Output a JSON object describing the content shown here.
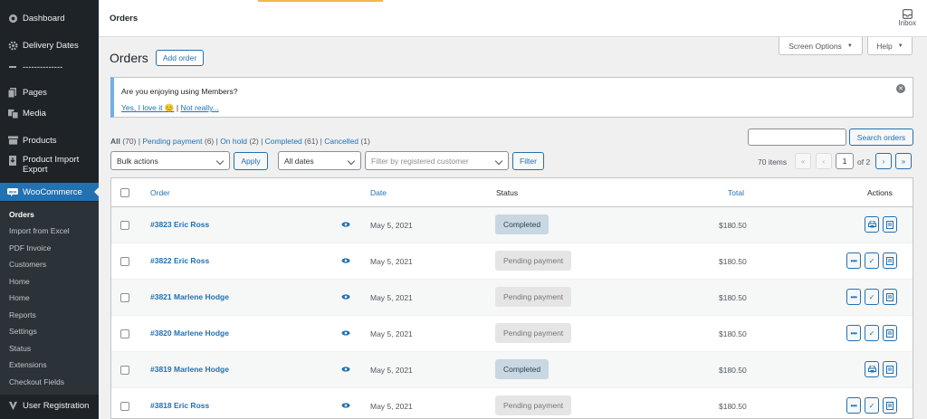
{
  "sidebar": {
    "items": [
      {
        "icon": "dashboard-icon",
        "label": "Dashboard"
      },
      {
        "icon": "gear-icon",
        "label": "Delivery Dates"
      },
      {
        "icon": "separator-icon",
        "label": "--------------"
      },
      {
        "icon": "pages-icon",
        "label": "Pages"
      },
      {
        "icon": "media-icon",
        "label": "Media"
      },
      {
        "icon": "products-icon",
        "label": "Products"
      },
      {
        "icon": "import-icon",
        "label": "Product Import Export"
      },
      {
        "icon": "woocommerce-icon",
        "label": "WooCommerce"
      }
    ],
    "submenu": [
      "Orders",
      "Import from Excel",
      "PDF Invoice",
      "Customers",
      "Home",
      "Home",
      "Reports",
      "Settings",
      "Status",
      "Extensions",
      "Checkout Fields"
    ],
    "bottom_item": {
      "icon": "user-registration-icon",
      "label": "User Registration"
    }
  },
  "topbar": {
    "title": "Orders",
    "inbox_label": "Inbox"
  },
  "screen_options_label": "Screen Options",
  "help_label": "Help",
  "page": {
    "title": "Orders",
    "add_order_label": "Add order"
  },
  "notice": {
    "text": "Are you enjoying using Members?",
    "yes_link": "Yes, I love it",
    "emoji": "😊",
    "separator": " | ",
    "no_link": "Not really..."
  },
  "filters": {
    "all": {
      "label": "All",
      "count": "(70)"
    },
    "pending": {
      "label": "Pending payment",
      "count": "(6)"
    },
    "on_hold": {
      "label": "On hold",
      "count": "(2)"
    },
    "completed": {
      "label": "Completed",
      "count": "(61)"
    },
    "cancelled": {
      "label": "Cancelled",
      "count": "(1)"
    },
    "sep": " | "
  },
  "toolbar": {
    "bulk_actions": "Bulk actions",
    "apply_label": "Apply",
    "all_dates": "All dates",
    "customer_placeholder": "Filter by registered customer",
    "filter_label": "Filter",
    "search_button": "Search orders",
    "items_count": "70 items",
    "current_page": "1",
    "of_pages": "of 2",
    "first": "«",
    "prev": "‹",
    "next": "›",
    "last": "»"
  },
  "table": {
    "columns": {
      "order": "Order",
      "date": "Date",
      "status": "Status",
      "total": "Total",
      "actions": "Actions"
    },
    "rows": [
      {
        "order": "#3823 Eric Ross",
        "date": "May 5, 2021",
        "status": "Completed",
        "status_type": "completed",
        "total": "$180.50"
      },
      {
        "order": "#3822 Eric Ross",
        "date": "May 5, 2021",
        "status": "Pending payment",
        "status_type": "pending",
        "total": "$180.50"
      },
      {
        "order": "#3821 Marlene Hodge",
        "date": "May 5, 2021",
        "status": "Pending payment",
        "status_type": "pending",
        "total": "$180.50"
      },
      {
        "order": "#3820 Marlene Hodge",
        "date": "May 5, 2021",
        "status": "Pending payment",
        "status_type": "pending",
        "total": "$180.50"
      },
      {
        "order": "#3819 Marlene Hodge",
        "date": "May 5, 2021",
        "status": "Completed",
        "status_type": "completed",
        "total": "$180.50"
      },
      {
        "order": "#3818 Eric Ross",
        "date": "May 5, 2021",
        "status": "Pending payment",
        "status_type": "pending",
        "total": "$180.50"
      }
    ]
  },
  "colors": {
    "accent": "#2271b1",
    "sidebar": "#1d2327",
    "completed_bg": "#c8d7e1",
    "pending_bg": "#e5e5e5"
  }
}
